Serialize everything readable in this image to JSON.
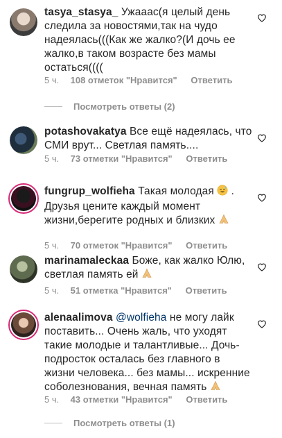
{
  "comments": [
    {
      "username": "tasya_stasya_",
      "text": "Ужааас(я целый день следила за новостями,так на чудо надеялась(((Как же жалко?(И дочь ее жалко,в таком возрасте без мамы остаться((((",
      "time": "5 ч.",
      "likes": "108 отметок \"Нравится\"",
      "reply": "Ответить",
      "view_replies": "Посмотреть ответы (2)"
    },
    {
      "username": "potashovakatya",
      "text": "Все ещё надеялась, что СМИ врут... Светлая память....",
      "time": "5 ч.",
      "likes": "73 отметки \"Нравится\"",
      "reply": "Ответить"
    },
    {
      "username": "fungrup_wolfieha",
      "text_before_emoji": "Такая молодая",
      "text_after_emoji": ". Друзья цените каждый момент жизни,берегите родных и близких",
      "emoji_1": "sweat-smile",
      "emoji_2": "praying-hands",
      "time": "5 ч.",
      "likes": "70 отметок \"Нравится\"",
      "reply": "Ответить"
    },
    {
      "username": "marinamaleckaa",
      "text": "Боже, как жалко Юлю, светлая память ей",
      "emoji": "praying-hands",
      "time": "5 ч.",
      "likes": "51 отметка \"Нравится\"",
      "reply": "Ответить"
    },
    {
      "username": "alenaalimova",
      "mention": "@wolfieha",
      "text": "не могу лайк поставить... Очень жаль, что уходят такие молодые и талантливые... Дочь-подросток осталась без главного в жизни человека... без мамы... искренние соболезнования, вечная память",
      "emoji": "praying-hands",
      "time": "5 ч.",
      "likes": "43 отметки \"Нравится\"",
      "reply": "Ответить",
      "view_replies": "Посмотреть ответы (1)"
    }
  ],
  "colors": {
    "text": "#262626",
    "meta": "#8e8e8e",
    "mention": "#003569",
    "story_ring": "#d62976"
  }
}
